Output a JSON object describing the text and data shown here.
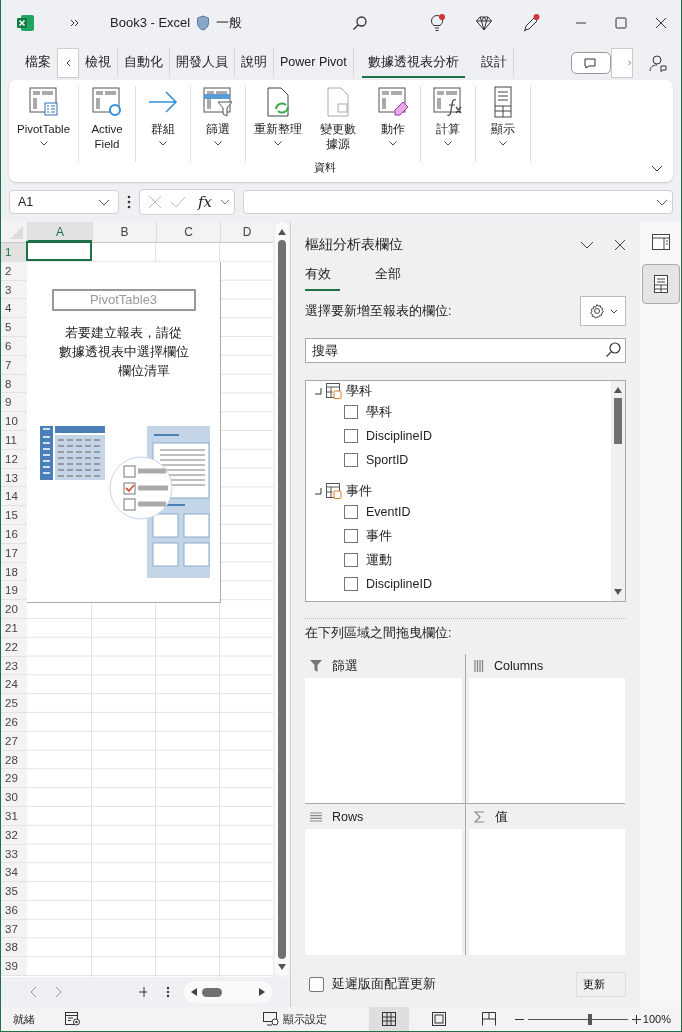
{
  "title_bar": {
    "title": "Book3 - Excel",
    "sensitivity": "一般"
  },
  "ribbon_tabs": [
    {
      "label": "檔案",
      "selected": false
    },
    {
      "label": "檢視",
      "selected": false
    },
    {
      "label": "自動化",
      "selected": false
    },
    {
      "label": "開發人員",
      "selected": false
    },
    {
      "label": "說明",
      "selected": false
    },
    {
      "label": "Power Pivot",
      "selected": false
    },
    {
      "label": "數據透視表分析",
      "selected": true
    },
    {
      "label": "設計",
      "selected": false
    }
  ],
  "ribbon": {
    "buttons": [
      {
        "label": "PivotTable",
        "dropdown": true
      },
      {
        "label": "Active Field",
        "dropdown": false
      },
      {
        "label": "群組",
        "dropdown": true
      },
      {
        "label": "篩選",
        "dropdown": true
      },
      {
        "label": "重新整理",
        "dropdown": true
      },
      {
        "label": "變更數據源",
        "dropdown": false
      },
      {
        "label": "動作",
        "dropdown": true
      },
      {
        "label": "計算",
        "dropdown": true
      },
      {
        "label": "顯示",
        "dropdown": true
      }
    ],
    "group_label": "資料"
  },
  "formula_bar": {
    "name_box": "A1",
    "function_label": "fx"
  },
  "sheet": {
    "columns": [
      {
        "label": "A",
        "selected": true
      },
      {
        "label": "B",
        "selected": false
      },
      {
        "label": "C",
        "selected": false
      },
      {
        "label": "D",
        "selected": false
      }
    ],
    "rows": [
      "1",
      "2",
      "3",
      "4",
      "5",
      "6",
      "7",
      "8",
      "9",
      "10",
      "11",
      "12",
      "13",
      "14",
      "15",
      "16",
      "17",
      "18",
      "19",
      "20",
      "21",
      "22",
      "23",
      "24",
      "25",
      "26",
      "27",
      "28",
      "29",
      "30",
      "31",
      "32",
      "33",
      "34",
      "35",
      "36",
      "37",
      "38",
      "39"
    ],
    "pivot_placeholder": {
      "name": "PivotTable3",
      "instructions": [
        "若要建立報表，請從",
        "數據透視表中選擇欄位",
        "欄位清單"
      ]
    }
  },
  "field_pane": {
    "title": "樞紐分析表欄位",
    "tabs": [
      {
        "label": "有效",
        "selected": true
      },
      {
        "label": "全部",
        "selected": false
      }
    ],
    "choose_label": "選擇要新增至報表的欄位:",
    "search": {
      "placeholder": "搜尋"
    },
    "tables": [
      {
        "name": "學科",
        "expanded": true,
        "fields": [
          {
            "name": "學科",
            "checked": false
          },
          {
            "name": "DisciplineID",
            "checked": false
          },
          {
            "name": "SportID",
            "checked": false
          }
        ]
      },
      {
        "name": "事件",
        "expanded": true,
        "fields": [
          {
            "name": "EventID",
            "checked": false
          },
          {
            "name": "事件",
            "checked": false
          },
          {
            "name": "運動",
            "checked": false
          },
          {
            "name": "DisciplineID",
            "checked": false
          }
        ]
      }
    ],
    "drag_label": "在下列區域之間拖曳欄位:",
    "areas": [
      {
        "kind": "filters",
        "label": "篩選"
      },
      {
        "kind": "columns",
        "label": "Columns"
      },
      {
        "kind": "rows",
        "label": "Rows"
      },
      {
        "kind": "values",
        "label": "值"
      }
    ],
    "defer_update": {
      "label": "延遲版面配置更新",
      "checked": false
    },
    "update_button": "更新"
  },
  "status_bar": {
    "status": "就緒",
    "display_settings": "顯示設定",
    "views": [
      {
        "kind": "normal",
        "selected": true
      },
      {
        "kind": "page_layout",
        "selected": false
      },
      {
        "kind": "page_break",
        "selected": false
      }
    ],
    "zoom": {
      "level": 0.62,
      "reading": "100%"
    }
  }
}
